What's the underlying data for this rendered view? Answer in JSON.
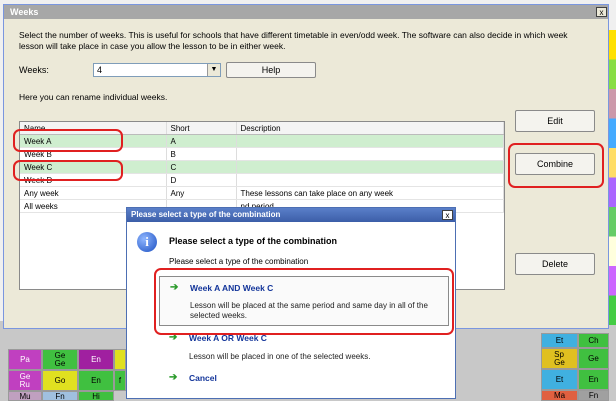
{
  "weeks_dialog": {
    "title": "Weeks",
    "intro": "Select the number of weeks. This is useful for schools that have different timetable in even/odd week. The software can also decide in which week lesson will take place in case you allow the lesson to be in either week.",
    "weeks_label": "Weeks:",
    "weeks_value": "4",
    "help_label": "Help",
    "rename_hint": "Here you can rename individual weeks.",
    "columns": [
      "Name",
      "Short",
      "Description"
    ],
    "rows": [
      {
        "name": "Week A",
        "short": "A",
        "description": ""
      },
      {
        "name": "Week B",
        "short": "B",
        "description": ""
      },
      {
        "name": "Week C",
        "short": "C",
        "description": ""
      },
      {
        "name": "Week D",
        "short": "D",
        "description": ""
      },
      {
        "name": "Any week",
        "short": "Any",
        "description": "These lessons can take place on any week"
      },
      {
        "name": "All weeks",
        "short": "",
        "description": "nd period"
      }
    ],
    "edit_label": "Edit",
    "combine_label": "Combine",
    "delete_label": "Delete",
    "close_glyph": "x"
  },
  "combine_dialog": {
    "title": "Please select a type of the combination",
    "close_glyph": "x",
    "heading": "Please select a type of the combination",
    "subtext": "Please select a type of the combination",
    "options": [
      {
        "title": "Week A AND Week C",
        "description": "Lesson will be placed at the same period and same day in all of the selected weeks."
      },
      {
        "title": "Week A OR Week C",
        "description": "Lesson will be placed in one of the selected weeks."
      },
      {
        "title": "Cancel",
        "description": ""
      }
    ]
  },
  "timetable": {
    "row1": [
      "Pa",
      "Ge\nGe",
      "En"
    ],
    "row2": [
      "Ge\nRu",
      "Go",
      "En",
      "f"
    ],
    "row3": [
      "Mu",
      "Fn",
      "Hi"
    ],
    "right_col1": [
      "Et",
      "Sp\nGe",
      "Et",
      "Ma"
    ],
    "right_col2": [
      "Ch",
      "Ge",
      "En",
      "Fn"
    ]
  },
  "colors": {
    "highlight_green": "#cfeecf",
    "annotation_red": "#e02020",
    "popup_title_blue": "#3c5ea8"
  }
}
